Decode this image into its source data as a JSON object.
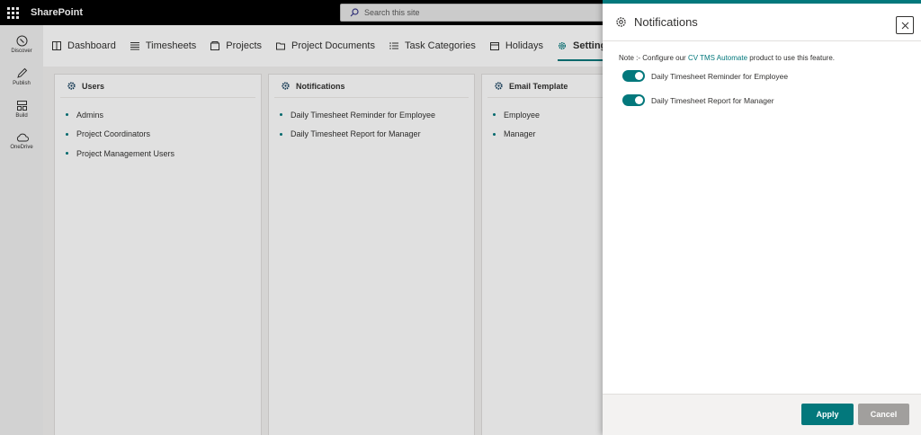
{
  "suite": {
    "app_name": "SharePoint",
    "search_placeholder": "Search this site"
  },
  "appbar": [
    {
      "label": "Discover",
      "icon": "compass-icon"
    },
    {
      "label": "Publish",
      "icon": "pen-icon"
    },
    {
      "label": "Build",
      "icon": "build-icon"
    },
    {
      "label": "OneDrive",
      "icon": "cloud-icon"
    }
  ],
  "nav": {
    "tabs": [
      {
        "label": "Dashboard"
      },
      {
        "label": "Timesheets"
      },
      {
        "label": "Projects"
      },
      {
        "label": "Project Documents"
      },
      {
        "label": "Task Categories"
      },
      {
        "label": "Holidays"
      },
      {
        "label": "Settings",
        "active": true
      }
    ]
  },
  "cards": [
    {
      "title": "Users",
      "items": [
        "Admins",
        "Project Coordinators",
        "Project Management Users"
      ]
    },
    {
      "title": "Notifications",
      "items": [
        "Daily Timesheet Reminder for Employee",
        "Daily Timesheet Report for Manager"
      ]
    },
    {
      "title": "Email Template",
      "items": [
        "Employee",
        "Manager"
      ]
    }
  ],
  "panel": {
    "title": "Notifications",
    "note_prefix": "Note :- Configure our ",
    "note_link": "CV TMS Automate",
    "note_suffix": " product to use this feature.",
    "toggles": [
      {
        "label": "Daily Timesheet Reminder for Employee",
        "on": true
      },
      {
        "label": "Daily Timesheet Report for Manager",
        "on": true
      }
    ],
    "apply_label": "Apply",
    "cancel_label": "Cancel"
  },
  "colors": {
    "accent": "#03787c",
    "suitebar": "#000000",
    "cancel": "#a19f9d"
  }
}
